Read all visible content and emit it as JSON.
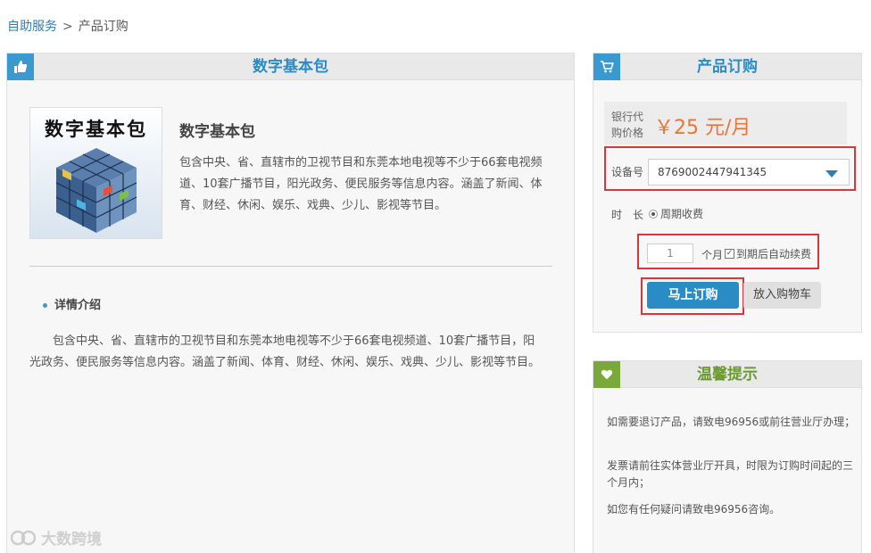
{
  "breadcrumb": {
    "home": "自助服务",
    "separator": ">",
    "current": "产品订购"
  },
  "product_panel": {
    "title": "数字基本包",
    "icon": "thumbs-up-icon",
    "image_title": "数字基本包",
    "name": "数字基本包",
    "description": "包含中央、省、直辖市的卫视节目和东莞本地电视等不少于66套电视频道、10套广播节目，阳光政务、便民服务等信息内容。涵盖了新闻、体育、财经、休闲、娱乐、戏典、少儿、影视等节目。",
    "detail_title": "详情介绍",
    "detail_text": "包含中央、省、直辖市的卫视节目和东莞本地电视等不少于66套电视频道、10套广播节目，阳光政务、便民服务等信息内容。涵盖了新闻、体育、财经、休闲、娱乐、戏典、少儿、影视等节目。"
  },
  "order_panel": {
    "title": "产品订购",
    "icon": "cart-icon",
    "price_label": "银行代购价格",
    "price_value": "￥25 元/月",
    "device_label": "设备号",
    "device_value": "8769002447941345",
    "duration_label": "时　长",
    "duration_option": "周期收费",
    "months_value": "1",
    "months_unit": "个月",
    "auto_renew_label": "到期后自动续费",
    "auto_renew_checked": true,
    "buy_label": "马上订购",
    "cart_label": "放入购物车"
  },
  "tips_panel": {
    "title": "温馨提示",
    "icon": "heart-icon",
    "tips": [
      "如需要退订产品，请致电96956或前往营业厅办理；",
      "发票请前往实体营业厅开具，时限为订购时间起的三个月内；",
      "如您有任何疑问请致电96956咨询。"
    ]
  },
  "watermark": {
    "text": "大数跨境"
  },
  "colors": {
    "accent_blue": "#2a8cc4",
    "accent_green": "#7aa83a",
    "price_orange": "#e8763a",
    "highlight_red": "#d9363b"
  }
}
